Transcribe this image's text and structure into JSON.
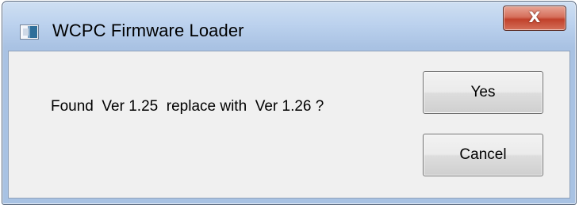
{
  "window": {
    "title": "WCPC Firmware Loader",
    "close_label": "X"
  },
  "dialog": {
    "message": "Found  Ver 1.25  replace with  Ver 1.26 ?",
    "yes_label": "Yes",
    "cancel_label": "Cancel"
  },
  "icons": {
    "app": "app-window-icon",
    "close": "close-icon"
  },
  "colors": {
    "frame": "#bcd2ee",
    "client": "#f0f0f0",
    "close_button": "#c1412b"
  }
}
